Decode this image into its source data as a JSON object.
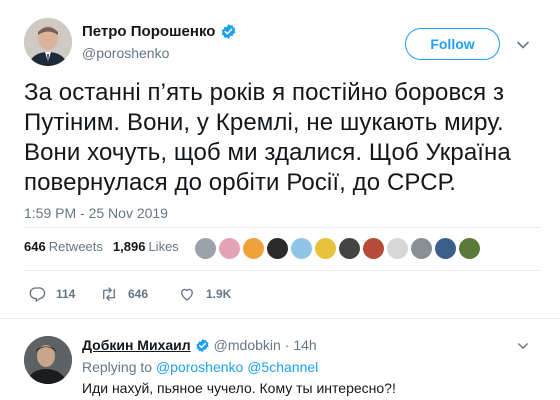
{
  "tweet": {
    "author_name": "Петро Порошенко",
    "author_handle": "@poroshenko",
    "follow_label": "Follow",
    "text": "За останні п’ять років я постійно боровся з Путіним. Вони, у Кремлі, не шукають миру. Вони хочуть, щоб ми здалися. Щоб Україна повернулася до орбіти Росії, до СРСР.",
    "timestamp": "1:59 PM - 25 Nov 2019",
    "retweets_count": "646",
    "retweets_label": "Retweets",
    "likes_count": "1,896",
    "likes_label": "Likes"
  },
  "actions": {
    "reply_count": "114",
    "retweet_count": "646",
    "like_count": "1.9K"
  },
  "likers": [
    {
      "icon": "liker-avatar",
      "color": "#9aa3ab"
    },
    {
      "icon": "liker-avatar",
      "color": "#e4a3b6"
    },
    {
      "icon": "liker-avatar",
      "color": "#f0a13a"
    },
    {
      "icon": "liker-avatar",
      "color": "#2a2a2a"
    },
    {
      "icon": "liker-avatar",
      "color": "#8fc6e8"
    },
    {
      "icon": "liker-avatar",
      "color": "#e8c23a"
    },
    {
      "icon": "liker-avatar",
      "color": "#444444"
    },
    {
      "icon": "liker-avatar",
      "color": "#b84a3a"
    },
    {
      "icon": "liker-avatar",
      "color": "#d7d7d7"
    },
    {
      "icon": "liker-avatar",
      "color": "#8a8f95"
    },
    {
      "icon": "liker-avatar",
      "color": "#3b5f8a"
    },
    {
      "icon": "liker-avatar",
      "color": "#5a7a3a"
    }
  ],
  "reply": {
    "author_name": "Добкин Михаил",
    "author_handle": "@mdobkin",
    "age": "· 14h",
    "replying_prefix": "Replying to",
    "replying_to_1": "@poroshenko",
    "replying_to_2": "@5channel",
    "text": "Иди нахуй, пьяное чучело. Кому ты интересно?!"
  },
  "colors": {
    "accent": "#1da1f2",
    "secondary_text": "#657786",
    "primary_text": "#14171a",
    "divider": "#e6ecf0"
  }
}
